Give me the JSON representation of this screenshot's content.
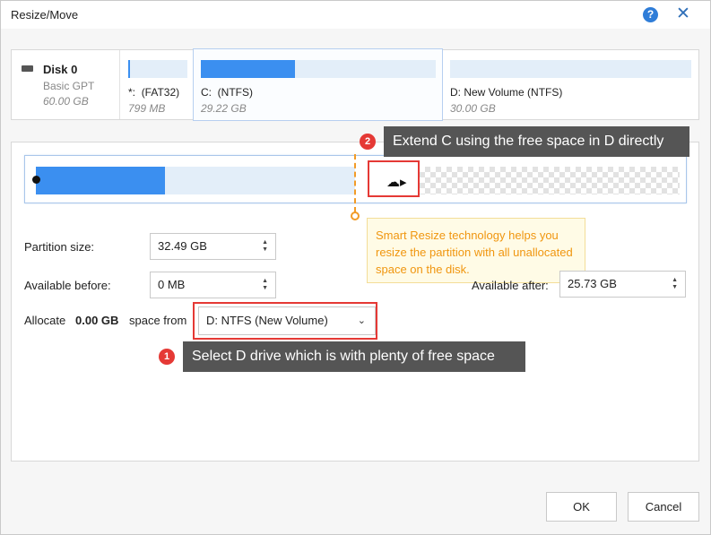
{
  "window": {
    "title": "Resize/Move",
    "help_icon": "question-circle-icon",
    "close_icon": "close-icon"
  },
  "disk": {
    "name": "Disk 0",
    "type": "Basic GPT",
    "size": "60.00 GB"
  },
  "partitions": [
    {
      "letter": "*:",
      "fs": "(FAT32)",
      "size": "799 MB",
      "used_fraction": 0.03
    },
    {
      "letter": "C:",
      "fs": "(NTFS)",
      "size": "29.22 GB",
      "used_fraction": 0.4,
      "selected": true
    },
    {
      "letter": "D:",
      "fs": "New Volume (NTFS)",
      "size": "30.00 GB",
      "used_fraction": 0.0
    }
  ],
  "callouts": {
    "step2": {
      "badge": "2",
      "text": "Extend C using the free space in D directly"
    },
    "step1": {
      "badge": "1",
      "text": "Select D drive which is with plenty of free space"
    }
  },
  "tooltip": {
    "text": "Smart Resize technology helps you resize the partition with all unallocated space on the disk."
  },
  "fields": {
    "partition_size": {
      "label": "Partition size:",
      "value": "32.49 GB"
    },
    "available_before": {
      "label": "Available before:",
      "value": "0 MB"
    },
    "available_after": {
      "label": "Available after:",
      "value": "25.73 GB"
    }
  },
  "allocate": {
    "label": "Allocate",
    "value": "0.00 GB",
    "space_from_label": "space from",
    "selected_source": "D: NTFS (New Volume)"
  },
  "buttons": {
    "ok": "OK",
    "cancel": "Cancel"
  },
  "colors": {
    "accent": "#3b8ff0",
    "callout_bg": "#555555",
    "highlight_red": "#e53935",
    "tip_orange": "#f0960f"
  }
}
